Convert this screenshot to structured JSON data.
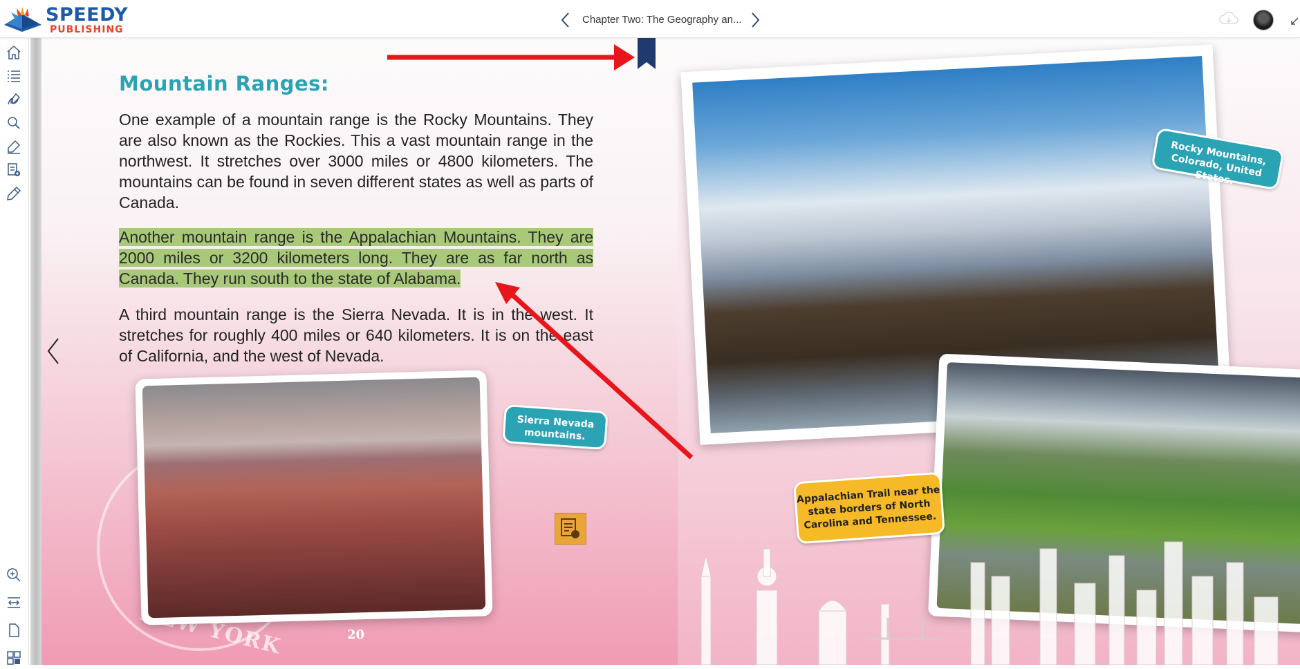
{
  "app": {
    "logo_main": "SPEEDY",
    "logo_sub": "PUBLISHING",
    "chapter_title": "Chapter Two: The Geography an..."
  },
  "toolbar": {
    "items": [
      "home-icon",
      "table-of-contents-icon",
      "handwriting-icon",
      "search-icon",
      "highlighter-icon",
      "add-note-icon",
      "pen-icon",
      "zoom-in-icon",
      "fit-width-icon",
      "page-icon",
      "thumbnails-icon"
    ]
  },
  "page": {
    "heading": "Mountain Ranges:",
    "paragraph1": "One example of a mountain range is the Rocky Mountains. They are also known as the Rockies. This a vast mountain range in the northwest. It stretches over 3000 miles or 4800 kilometers. The mountains can be found in seven different states as well as parts of Canada.",
    "paragraph2_highlighted": "Another mountain range is the Appalachian Mountains. They are 2000 miles or 3200 kilometers long. They are as far north as Canada. They run south to the state of Alabama.",
    "paragraph3": "A third mountain range is the Sierra Nevada. It is in the west. It stretches for roughly 400 miles or 640 kilometers. It is on the east of California, and the west of Nevada.",
    "page_number": "20",
    "stamp_text": "NEW YORK",
    "highlight_color": "#a9c97a"
  },
  "captions": {
    "sierra": "Sierra Nevada mountains.",
    "rocky": "Rocky Mountains, Colorado, United States.",
    "appalachian": "Appalachian Trail near the state borders of North Carolina and Tennessee."
  },
  "colors": {
    "accent_teal": "#2aa3b5",
    "bookmark_active": "#1e3a6e",
    "annotation_arrow": "#e8151b",
    "tag_yellow": "#f6b928"
  }
}
